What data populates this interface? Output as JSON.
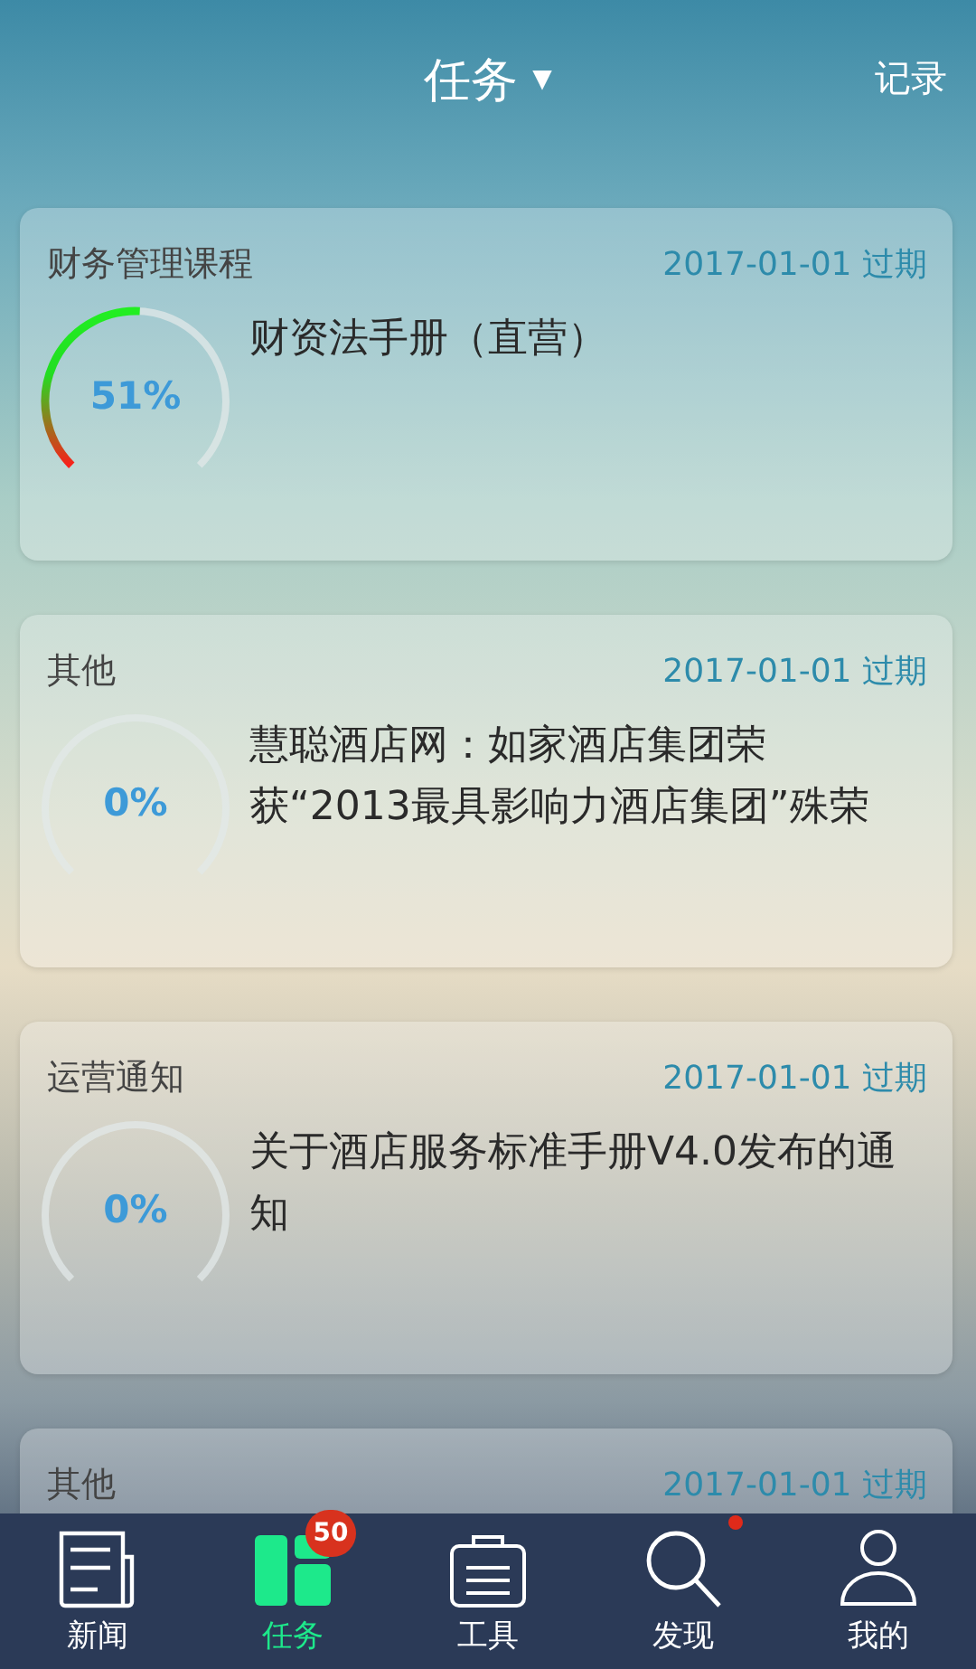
{
  "header": {
    "title": "任务",
    "dropdown_icon": "▼",
    "action": "记录"
  },
  "tasks": [
    {
      "category": "财务管理课程",
      "date": "2017-01-01 过期",
      "percent": "51%",
      "title": "财资法手册（直营）"
    },
    {
      "category": "其他",
      "date": "2017-01-01 过期",
      "percent": "0%",
      "title": "慧聪酒店网：如家酒店集团荣获“2013最具影响力酒店集团”殊荣"
    },
    {
      "category": "运营通知",
      "date": "2017-01-01 过期",
      "percent": "0%",
      "title": "关于酒店服务标准手册V4.0发布的通知"
    },
    {
      "category": "其他",
      "date": "2017-01-01 过期"
    }
  ],
  "tab_bar": [
    {
      "label": "新闻",
      "selected": false
    },
    {
      "label": "任务",
      "selected": true,
      "badge": "50"
    },
    {
      "label": "工具",
      "selected": false
    },
    {
      "label": "发现",
      "selected": false,
      "dot": true
    },
    {
      "label": "我的",
      "selected": false
    }
  ]
}
